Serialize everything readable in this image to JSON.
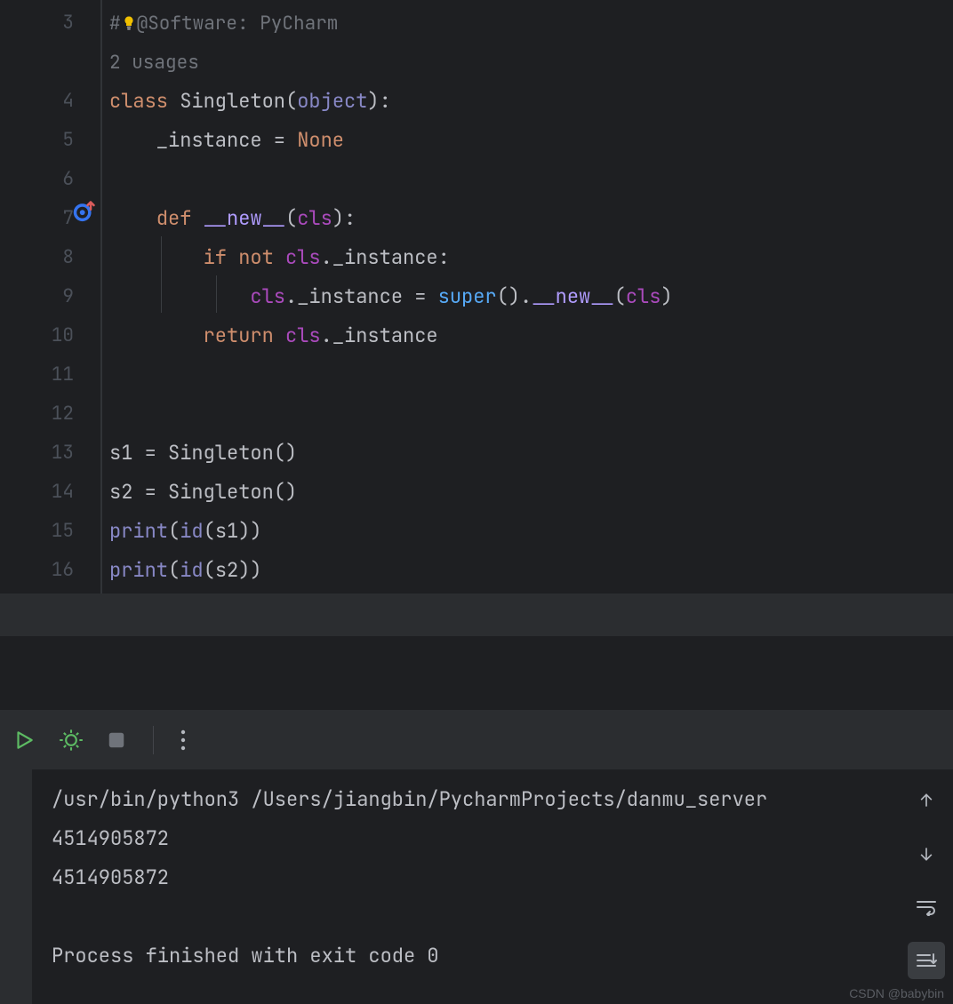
{
  "editor": {
    "usages_hint": "2 usages",
    "lines": {
      "3": {
        "num": "3",
        "tokens": [
          {
            "t": "# @Software: PyCharm",
            "c": "hint"
          }
        ],
        "bulb": true
      },
      "3b": {
        "tokens": [
          {
            "t": "2 usages",
            "c": "hint"
          }
        ]
      },
      "4": {
        "num": "4",
        "tokens": [
          {
            "t": "class ",
            "c": "kw"
          },
          {
            "t": "Singleton",
            "c": "ident"
          },
          {
            "t": "(",
            "c": "ident"
          },
          {
            "t": "object",
            "c": "builtin"
          },
          {
            "t": "):",
            "c": "ident"
          }
        ]
      },
      "5": {
        "num": "5",
        "tokens": [
          {
            "t": "    _instance = ",
            "c": "ident"
          },
          {
            "t": "None",
            "c": "none"
          }
        ]
      },
      "6": {
        "num": "6",
        "tokens": []
      },
      "7": {
        "num": "7",
        "tokens": [
          {
            "t": "    ",
            "c": "ident"
          },
          {
            "t": "def ",
            "c": "kw"
          },
          {
            "t": "__new__",
            "c": "fn"
          },
          {
            "t": "(",
            "c": "ident"
          },
          {
            "t": "cls",
            "c": "self"
          },
          {
            "t": "):",
            "c": "ident"
          }
        ],
        "override": true
      },
      "8": {
        "num": "8",
        "tokens": [
          {
            "t": "        ",
            "c": "ident"
          },
          {
            "t": "if not ",
            "c": "kw"
          },
          {
            "t": "cls",
            "c": "self"
          },
          {
            "t": "._instance:",
            "c": "ident"
          }
        ]
      },
      "9": {
        "num": "9",
        "tokens": [
          {
            "t": "            ",
            "c": "ident"
          },
          {
            "t": "cls",
            "c": "self"
          },
          {
            "t": "._instance = ",
            "c": "ident"
          },
          {
            "t": "super",
            "c": "call"
          },
          {
            "t": "().",
            "c": "ident"
          },
          {
            "t": "__new__",
            "c": "fn"
          },
          {
            "t": "(",
            "c": "ident"
          },
          {
            "t": "cls",
            "c": "self"
          },
          {
            "t": ")",
            "c": "ident"
          }
        ]
      },
      "10": {
        "num": "10",
        "tokens": [
          {
            "t": "        ",
            "c": "ident"
          },
          {
            "t": "return ",
            "c": "kw"
          },
          {
            "t": "cls",
            "c": "self"
          },
          {
            "t": "._instance",
            "c": "ident"
          }
        ]
      },
      "11": {
        "num": "11",
        "tokens": []
      },
      "12": {
        "num": "12",
        "tokens": []
      },
      "13": {
        "num": "13",
        "tokens": [
          {
            "t": "s1 = Singleton()",
            "c": "ident"
          }
        ]
      },
      "14": {
        "num": "14",
        "tokens": [
          {
            "t": "s2 = Singleton()",
            "c": "ident"
          }
        ]
      },
      "15": {
        "num": "15",
        "tokens": [
          {
            "t": "print",
            "c": "builtin"
          },
          {
            "t": "(",
            "c": "ident"
          },
          {
            "t": "id",
            "c": "builtin"
          },
          {
            "t": "(s1))",
            "c": "ident"
          }
        ]
      },
      "16": {
        "num": "16",
        "tokens": [
          {
            "t": "print",
            "c": "builtin"
          },
          {
            "t": "(",
            "c": "ident"
          },
          {
            "t": "id",
            "c": "builtin"
          },
          {
            "t": "(s2))",
            "c": "ident"
          }
        ]
      }
    },
    "line_order": [
      "3",
      "3b",
      "4",
      "5",
      "6",
      "7",
      "8",
      "9",
      "10",
      "11",
      "12",
      "13",
      "14",
      "15",
      "16"
    ]
  },
  "console": {
    "cmd": "/usr/bin/python3 /Users/jiangbin/PycharmProjects/danmu_server",
    "out1": "4514905872",
    "out2": "4514905872",
    "status": "Process finished with exit code 0"
  },
  "watermark": "CSDN @babybin"
}
